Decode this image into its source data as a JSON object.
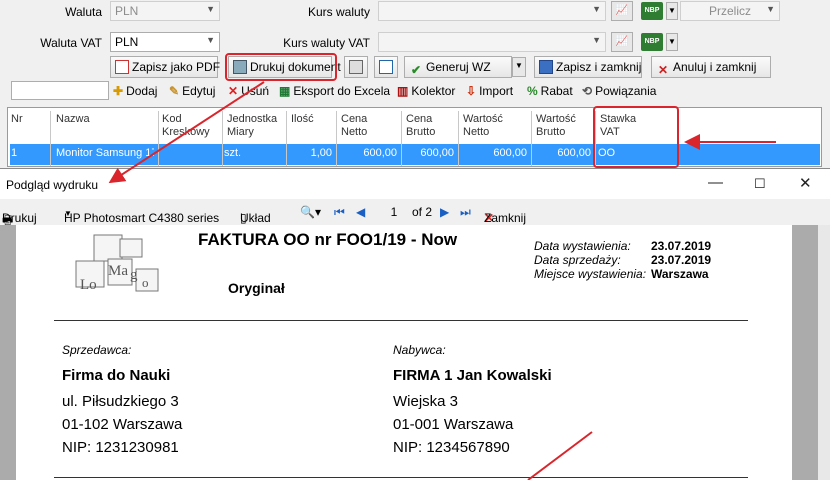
{
  "form": {
    "waluta_label": "Waluta",
    "waluta_value": "PLN",
    "kurs_label": "Kurs waluty",
    "waluta_vat_label": "Waluta VAT",
    "waluta_vat_value": "PLN",
    "kurs_vat_label": "Kurs waluty VAT",
    "nbp_label": "NBP",
    "przelicz_label": "Przelicz"
  },
  "actions": {
    "pdf": "Zapisz jako PDF",
    "print": "Drukuj dokument",
    "wz": "Generuj WZ",
    "save_close": "Zapisz i zamknij",
    "cancel_close": "Anuluj i zamknij"
  },
  "toolbar": {
    "search_value": "",
    "add": "Dodaj",
    "edit": "Edytuj",
    "delete": "Usuń",
    "excel": "Eksport do Excela",
    "collector": "Kolektor",
    "import": "Import",
    "discount": "Rabat",
    "links": "Powiązania"
  },
  "grid": {
    "columns": [
      "Nr",
      "Nazwa",
      "Kod\nKreskowy",
      "Jednostka\nMiary",
      "Ilość",
      "Cena\nNetto",
      "Cena\nBrutto",
      "Wartość\nNetto",
      "Wartość\nBrutto",
      "Stawka\nVAT"
    ],
    "row": [
      "1",
      "Monitor Samsung 17",
      "",
      "szt.",
      "1,00",
      "600,00",
      "600,00",
      "600,00",
      "600,00",
      "OO"
    ]
  },
  "preview": {
    "title": "Podgląd wydruku",
    "print": "Drukuj",
    "printer": "HP Photosmart C4380 series",
    "layout": "Układ",
    "page": "1",
    "of": "of 2",
    "close": "Zamknij"
  },
  "invoice": {
    "title": "FAKTURA OO nr FOO1/19 - Now",
    "original": "Oryginał",
    "issue_label": "Data wystawienia:",
    "issue_date": "23.07.2019",
    "sale_label": "Data sprzedaży:",
    "sale_date": "23.07.2019",
    "place_label": "Miejsce wystawienia:",
    "place": "Warszawa",
    "logo_letters": [
      "Ma",
      "g",
      "Lo",
      "o"
    ],
    "seller_label": "Sprzedawca:",
    "seller_name": "Firma do Nauki",
    "seller_street": "ul. Piłsudzkiego 3",
    "seller_city": "01-102  Warszawa",
    "seller_nip": "NIP: 1231230981",
    "buyer_label": "Nabywca:",
    "buyer_name": "FIRMA 1 Jan Kowalski",
    "buyer_street": "Wiejska 3",
    "buyer_city": "01-001  Warszawa",
    "buyer_nip": "NIP: 1234567890"
  },
  "colors": {
    "accent": "#3399ff",
    "highlight": "#d9252b"
  }
}
